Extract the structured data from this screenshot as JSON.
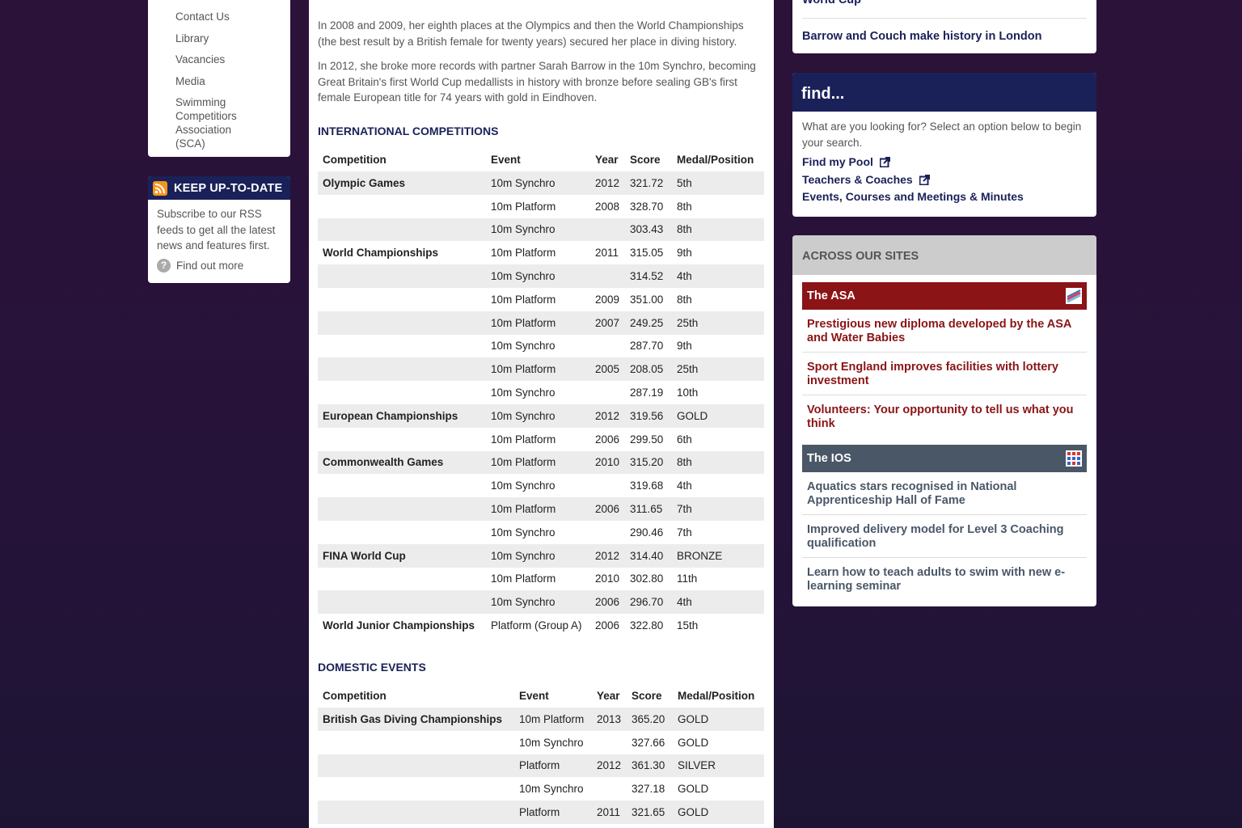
{
  "left_nav": {
    "links": [
      "Contact Us",
      "Library",
      "Vacancies",
      "Media",
      "Swimming Competitiors Association (SCA)"
    ]
  },
  "rss": {
    "title": "KEEP UP-TO-DATE",
    "text": "Subscribe to our RSS feeds to get all the latest news and features first.",
    "more": "Find out more",
    "icon": "rss-icon"
  },
  "main": {
    "para1": "In 2008 and 2009, her eighth places at the Olympics and then the World Championships (the best result by a British female for twenty years) secured her place in diving history.",
    "para2": "In 2012, she broke more records with partner Sarah Barrow in the 10m Synchro, becoming Great Britain's first World Cup medallists in history with bronze before sealing GB's first female European title for 74 years with gold in Eindhoven.",
    "international": {
      "title": "INTERNATIONAL COMPETITIONS",
      "headers": [
        "Competition",
        "Event",
        "Year",
        "Score",
        "Medal/Position"
      ],
      "rows": [
        [
          "Olympic Games",
          "10m Synchro",
          "2012",
          "321.72",
          "5th"
        ],
        [
          "",
          "10m Platform",
          "2008",
          "328.70",
          "8th"
        ],
        [
          "",
          "10m Synchro",
          "",
          "303.43",
          "8th"
        ],
        [
          "World Championships",
          "10m Platform",
          "2011",
          "315.05",
          "9th"
        ],
        [
          "",
          "10m Synchro",
          "",
          "314.52",
          "4th"
        ],
        [
          "",
          "10m Platform",
          "2009",
          "351.00",
          "8th"
        ],
        [
          "",
          "10m Platform",
          "2007",
          "249.25",
          "25th"
        ],
        [
          "",
          "10m Synchro",
          "",
          "287.70",
          "9th"
        ],
        [
          "",
          "10m Platform",
          "2005",
          "208.05",
          "25th"
        ],
        [
          "",
          "10m Synchro",
          "",
          "287.19",
          "10th"
        ],
        [
          "European Championships",
          "10m Synchro",
          "2012",
          "319.56",
          "GOLD"
        ],
        [
          "",
          "10m Platform",
          "2006",
          "299.50",
          "6th"
        ],
        [
          "Commonwealth Games",
          "10m Platform",
          "2010",
          "315.20",
          "8th"
        ],
        [
          "",
          "10m Synchro",
          "",
          "319.68",
          "4th"
        ],
        [
          "",
          "10m Platform",
          "2006",
          "311.65",
          "7th"
        ],
        [
          "",
          "10m Synchro",
          "",
          "290.46",
          "7th"
        ],
        [
          "FINA World Cup",
          "10m Synchro",
          "2012",
          "314.40",
          "BRONZE"
        ],
        [
          "",
          "10m Platform",
          "2010",
          "302.80",
          "11th"
        ],
        [
          "",
          "10m Synchro",
          "2006",
          "296.70",
          "4th"
        ],
        [
          "World Junior Championships",
          "Platform (Group A)",
          "2006",
          "322.80",
          "15th"
        ]
      ]
    },
    "domestic": {
      "title": "DOMESTIC EVENTS",
      "headers": [
        "Competition",
        "Event",
        "Year",
        "Score",
        "Medal/Position"
      ],
      "rows": [
        [
          "British Gas Diving Championships",
          "10m Platform",
          "2013",
          "365.20",
          "GOLD"
        ],
        [
          "",
          "10m Synchro",
          "",
          "327.66",
          "GOLD"
        ],
        [
          "",
          "Platform",
          "2012",
          "361.30",
          "SILVER"
        ],
        [
          "",
          "10m Synchro",
          "",
          "327.18",
          "GOLD"
        ],
        [
          "",
          "Platform",
          "2011",
          "321.65",
          "GOLD"
        ]
      ]
    }
  },
  "right": {
    "news_top": [
      "World Cup",
      "Barrow and Couch make history in London"
    ],
    "find": {
      "title": "find...",
      "text": "What are you looking for? Select an option below to begin your search.",
      "links": [
        "Find my Pool",
        "Teachers & Coaches",
        "Events, Courses and Meetings & Minutes"
      ]
    },
    "across": {
      "title": "ACROSS OUR SITES",
      "asa": {
        "name": "The ASA",
        "color": "#8b1416",
        "news": [
          "Prestigious new diploma developed by the ASA and Water Babies",
          "Sport England improves facilities with lottery investment",
          "Volunteers: Your opportunity to tell us what you think"
        ]
      },
      "ios": {
        "name": "The IOS",
        "color": "#4a5767",
        "news": [
          "Aquatics stars recognised in National Apprenticeship Hall of Fame",
          "Improved delivery model for Level 3 Coaching qualification",
          "Learn how to teach adults to swim with new e-learning seminar"
        ]
      }
    }
  }
}
